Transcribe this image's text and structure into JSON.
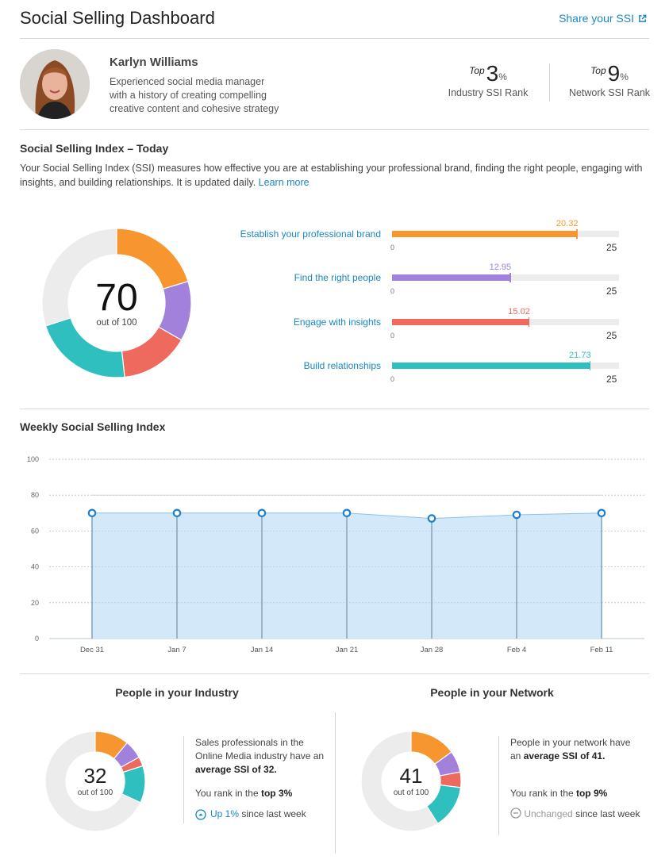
{
  "header": {
    "title": "Social Selling Dashboard",
    "share_label": "Share your SSI",
    "share_icon": "external-link-icon"
  },
  "profile": {
    "name": "Karlyn Williams",
    "bio_lines": [
      "Experienced social media manager",
      "with a history of creating compelling",
      "creative content and cohesive strategy"
    ],
    "ranks": [
      {
        "prefix": "Top",
        "value": "3",
        "suffix": "%",
        "label": "Industry SSI Rank"
      },
      {
        "prefix": "Top",
        "value": "9",
        "suffix": "%",
        "label": "Network SSI Rank"
      }
    ]
  },
  "ssi_today": {
    "title": "Social Selling Index – Today",
    "description": "Your Social Selling Index (SSI) measures how effective you are at establishing your professional brand, finding the right people, engaging with insights, and building relationships. It is updated daily.",
    "learn_more": "Learn more",
    "score": "70",
    "out_of": "out of 100"
  },
  "colors": {
    "brand": "#f7952f",
    "people": "#a281dc",
    "insights": "#ef6a5e",
    "relationships": "#2fbfbe",
    "remainder": "#ececec",
    "link": "#1a87c4",
    "chart_line": "#1e7fd0",
    "chart_fill": "#d3e8f9"
  },
  "chart_data": [
    {
      "type": "bar",
      "title": "Social Selling Index – Today (components)",
      "categories": [
        "Establish your professional brand",
        "Find the right people",
        "Engage with insights",
        "Build relationships"
      ],
      "values": [
        20.32,
        12.95,
        15.02,
        21.73
      ],
      "value_labels": [
        "20.32",
        "12.95",
        "15.02",
        "21.73"
      ],
      "colors": [
        "#f7952f",
        "#a281dc",
        "#ef6a5e",
        "#2fbfbe"
      ],
      "xlim": [
        0,
        25
      ],
      "min_label": "0",
      "max_label": "25"
    },
    {
      "type": "pie",
      "title": "SSI Today",
      "total": 100,
      "series": [
        {
          "name": "Establish your professional brand",
          "value": 20.32,
          "color": "#f7952f"
        },
        {
          "name": "Find the right people",
          "value": 12.95,
          "color": "#a281dc"
        },
        {
          "name": "Engage with insights",
          "value": 15.02,
          "color": "#ef6a5e"
        },
        {
          "name": "Build relationships",
          "value": 21.73,
          "color": "#2fbfbe"
        }
      ]
    },
    {
      "type": "area",
      "title": "Weekly Social Selling Index",
      "x": [
        "Dec 31",
        "Jan 7",
        "Jan 14",
        "Jan 21",
        "Jan 28",
        "Feb 4",
        "Feb 11"
      ],
      "values": [
        70,
        70,
        70,
        70,
        67,
        69,
        70
      ],
      "ylim": [
        0,
        100
      ],
      "yticks": [
        "0",
        "20",
        "40",
        "60",
        "80",
        "100"
      ],
      "grid": true,
      "xlabel": "",
      "ylabel": ""
    },
    {
      "type": "pie",
      "title": "People in your Industry",
      "total": 100,
      "series": [
        {
          "name": "Establish your professional brand",
          "value": 11,
          "color": "#f7952f"
        },
        {
          "name": "Find the right people",
          "value": 6,
          "color": "#a281dc"
        },
        {
          "name": "Engage with insights",
          "value": 3,
          "color": "#ef6a5e"
        },
        {
          "name": "Build relationships",
          "value": 12,
          "color": "#2fbfbe"
        }
      ]
    },
    {
      "type": "pie",
      "title": "People in your Network",
      "total": 100,
      "series": [
        {
          "name": "Establish your professional brand",
          "value": 15,
          "color": "#f7952f"
        },
        {
          "name": "Find the right people",
          "value": 7,
          "color": "#a281dc"
        },
        {
          "name": "Engage with insights",
          "value": 5,
          "color": "#ef6a5e"
        },
        {
          "name": "Build relationships",
          "value": 14,
          "color": "#2fbfbe"
        }
      ]
    }
  ],
  "weekly": {
    "title": "Weekly Social Selling Index"
  },
  "industry": {
    "title": "People in your Industry",
    "score": "32",
    "out_of": "out of 100",
    "text_pre": "Sales professionals in the Online Media industry have an ",
    "text_bold": "average SSI of 32.",
    "rank_pre": "You rank in the ",
    "rank_bold": "top 3%",
    "trend_icon": "arrow-up-circle-icon",
    "trend_label": "Up 1%",
    "trend_suffix": " since last week"
  },
  "network": {
    "title": "People in your Network",
    "score": "41",
    "out_of": "out of 100",
    "text_pre": "People in your network have an ",
    "text_bold": "average SSI of 41.",
    "rank_pre": "You rank in the ",
    "rank_bold": "top 9%",
    "trend_icon": "minus-circle-icon",
    "trend_label": "Unchanged",
    "trend_suffix": " since last week"
  }
}
